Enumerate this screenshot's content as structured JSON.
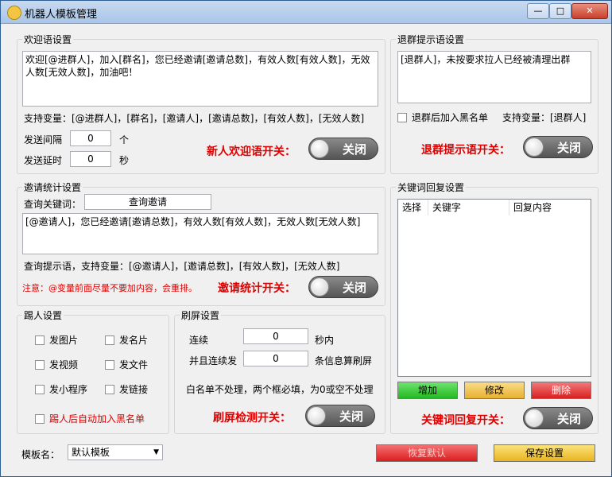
{
  "window": {
    "title": "机器人模板管理",
    "min": "—",
    "max": "□",
    "close": "✕"
  },
  "welcome": {
    "group_title": "欢迎语设置",
    "message": "欢迎[@进群人]，加入[群名]，您已经邀请[邀请总数]，有效人数[有效人数]，无效人数[无效人数]，加油吧！",
    "vars": "支持变量：[@进群人]，[群名]，[邀请人]，[邀请总数]，[有效人数]，[无效人数]",
    "interval_label": "发送间隔",
    "interval_value": "0",
    "interval_unit": "个",
    "delay_label": "发送延时",
    "delay_value": "0",
    "delay_unit": "秒",
    "switch_label": "新人欢迎语开关：",
    "switch_state": "关闭"
  },
  "quit": {
    "group_title": "退群提示语设置",
    "message": "[退群人]，未按要求拉人已经被清理出群",
    "blacklist_label": "退群后加入黑名单",
    "vars": "支持变量：[退群人]",
    "switch_label": "退群提示语开关：",
    "switch_state": "关闭"
  },
  "invite": {
    "group_title": "邀请统计设置",
    "keyword_label": "查询关键词：",
    "keyword_value": "查询邀请",
    "message": "[@邀请人]，您已经邀请[邀请总数]，有效人数[有效人数]，无效人数[无效人数]",
    "vars": "查询提示语，支持变量：[@邀请人]，[邀请总数]，[有效人数]，[无效人数]",
    "note": "注意：@变量前面尽量不要加内容，会重排。",
    "switch_label": "邀请统计开关：",
    "switch_state": "关闭"
  },
  "kick": {
    "group_title": "踢人设置",
    "options": [
      "发图片",
      "发名片",
      "发视频",
      "发文件",
      "发小程序",
      "发链接"
    ],
    "blacklist_label": "踢人后自动加入黑名单"
  },
  "flood": {
    "group_title": "刷屏设置",
    "row1_label": "连续",
    "row1_value": "0",
    "row1_unit": "秒内",
    "row2_label": "并且连续发",
    "row2_value": "0",
    "row2_unit": "条信息算刷屏",
    "note": "白名单不处理，两个框必填，为0或空不处理",
    "switch_label": "刷屏检测开关：",
    "switch_state": "关闭"
  },
  "keyword": {
    "group_title": "关键词回复设置",
    "columns": [
      "选择",
      "关键字",
      "回复内容"
    ],
    "add": "增加",
    "edit": "修改",
    "delete": "删除",
    "switch_label": "关键词回复开关：",
    "switch_state": "关闭"
  },
  "footer": {
    "template_label": "模板名：",
    "template_value": "默认模板",
    "restore": "恢复默认",
    "save": "保存设置"
  },
  "colors": {
    "switch_label": "#e00000",
    "add_btn": "#33cc33",
    "edit_btn": "#f2c04a",
    "delete_btn": "#e83030"
  }
}
